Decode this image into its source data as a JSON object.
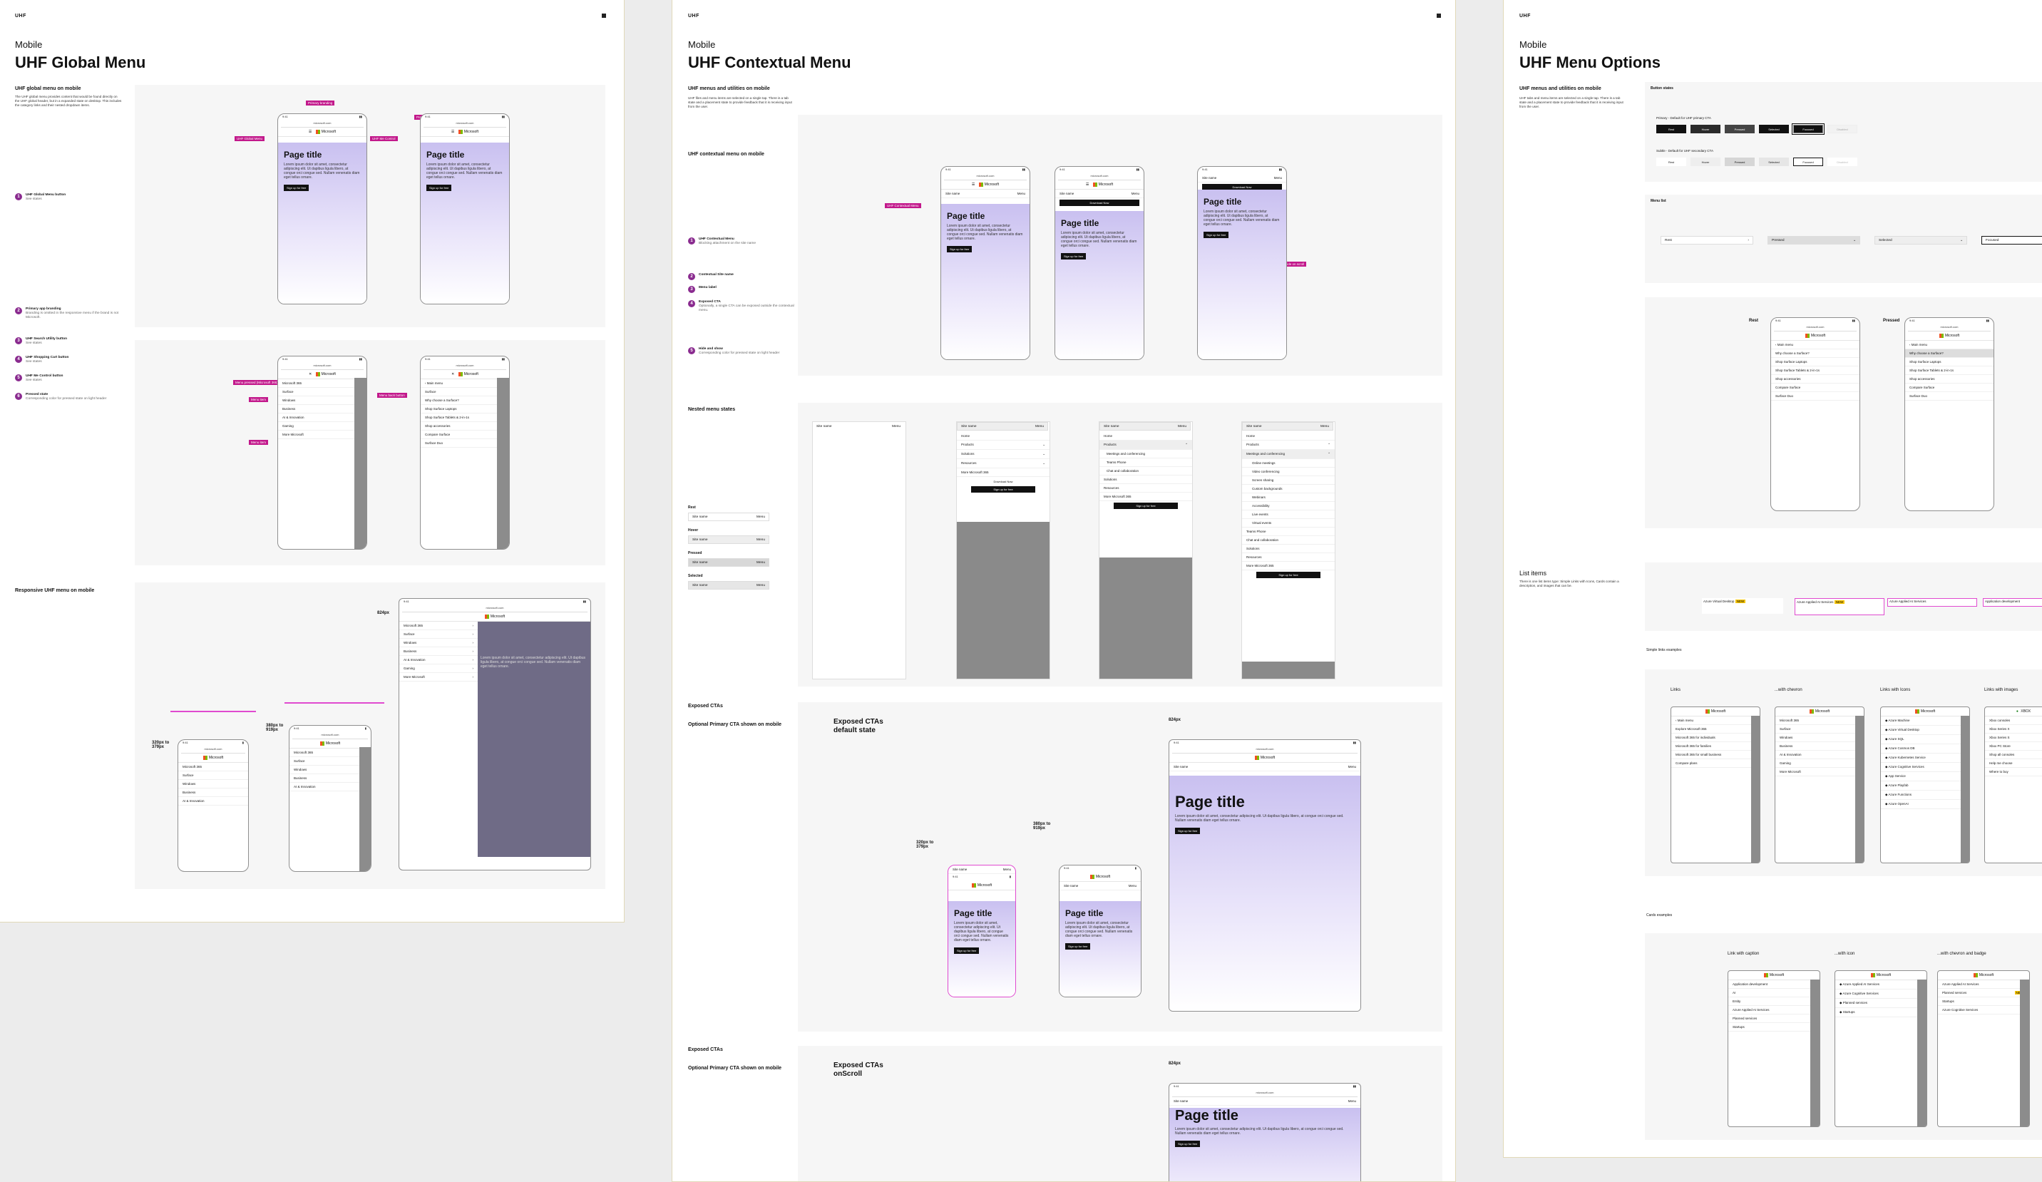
{
  "brand_short": "UHF",
  "boards": [
    {
      "kicker": "Mobile",
      "title": "UHF Global Menu"
    },
    {
      "kicker": "Mobile",
      "title": "UHF Contextual Menu"
    },
    {
      "kicker": "Mobile",
      "title": "UHF Menu Options"
    }
  ],
  "global": {
    "section1": "UHF global menu on mobile",
    "intro": "The UHF global menu provides content that would be found directly on the UHF global header, but in a expanded state on desktop. This includes the category links and their nested dropdown items.",
    "steps": [
      {
        "n": "1",
        "label": "UHF Global Menu button",
        "desc": "See states"
      },
      {
        "n": "2",
        "label": "Primary app branding",
        "desc": "Branding is omitted in the responsive menu if the brand is not Microsoft."
      },
      {
        "n": "3",
        "label": "UHF Search Utility button",
        "desc": "See states"
      },
      {
        "n": "4",
        "label": "UHF Shopping Cart button",
        "desc": "See states"
      },
      {
        "n": "5",
        "label": "UHF Me Control button",
        "desc": "See states"
      },
      {
        "n": "6",
        "label": "Pressed state",
        "desc": "Corresponding color for pressed state on light header"
      }
    ],
    "section2": "Responsive UHF menu on mobile",
    "bp1": "320px to 379px",
    "bp2": "380px to 919px",
    "bp3": "824px",
    "tags": [
      "Primary branding",
      "UHF Global Menu",
      "UHF Search",
      "UHF Cart",
      "UHF Me Control",
      "Pressed state",
      "Menu pressed (Microsoft 365)",
      "Menu item",
      "Menu item",
      "Menu back button"
    ],
    "phone_url": "microsoft.com",
    "phone_time": "9:41",
    "brand": "Microsoft",
    "page_title": "Page title",
    "body": "Lorem ipsum dolor sit amet, consectetur adipiscing elit. Ut dapibus ligula libero, at congue orci congue sed. Nullam venenatis diam eget tellus ornare.",
    "cta_link": "Sign up for free",
    "cta_primary": "Sign up for free",
    "menu_items": [
      "Microsoft 365",
      "Surface",
      "Windows",
      "Business",
      "AI & Innovation",
      "Gaming",
      "More Microsoft"
    ],
    "submenu_back": "Main menu",
    "submenu_head": "Surface",
    "submenu_items": [
      "Why choose a Surface?",
      "Shop Surface Laptops",
      "Shop Surface Tablets & 2-in-1s",
      "Shop accessories",
      "Compare Surface",
      "Surface Duo"
    ]
  },
  "contextual": {
    "section1": "UHF menus and utilities on mobile",
    "intro": "UHF files and menu items are selected on a single tap. There is a tab state and a placement state to provide feedback that it is receiving input from the user.",
    "section2": "UHF contextual menu on mobile",
    "steps": [
      {
        "n": "1",
        "label": "UHF Contextual Menu",
        "desc": "Blocking attachment on the site name"
      },
      {
        "n": "2",
        "label": "Contextual Site name",
        "desc": ""
      },
      {
        "n": "3",
        "label": "Menu label",
        "desc": ""
      },
      {
        "n": "4",
        "label": "Exposed CTA",
        "desc": "Optionally, a single CTA can be exposed outside the contextual menu."
      },
      {
        "n": "5",
        "label": "Hide and show",
        "desc": "Corresponding color for pressed state on light header"
      }
    ],
    "section3": "Nested menu states",
    "state_labels": [
      "Rest",
      "Hover",
      "Pressed",
      "Selected"
    ],
    "site_name": "Site name",
    "menu_label": "Menu",
    "download": "Download Now",
    "ctx_items": [
      "Home",
      "Products",
      "Solutions",
      "Resources",
      "More Microsoft 365"
    ],
    "ctx_sub": [
      "Meetings and conferencing",
      "Teams Phone",
      "Chat and collaboration"
    ],
    "ctx_sub2": [
      "Online meetings",
      "Video conferencing",
      "Screen sharing",
      "Custom backgrounds",
      "Webinars",
      "Accessibility",
      "Live events",
      "Virtual events"
    ],
    "section4": "Exposed CTAs",
    "opt_cta": "Optional Primary CTA shown on mobile",
    "exposed_default": "Exposed CTAs default state",
    "exposed_scroll": "Exposed CTAs onScroll",
    "bp1": "320px to 379px",
    "bp2": "380px to 919px",
    "bp3": "824px",
    "tags": [
      "UHF Contextual Menu",
      "Contextual Site name",
      "Menu label",
      "Optional exposed CTA",
      "Hide on scroll"
    ]
  },
  "options": {
    "section1": "UHF menus and utilities on mobile",
    "intro": "UHF tabs and menu items are selected on a single tap. There is a tab state and a placement state to provide feedback that it is receiving input from the user.",
    "button_states": "Button states",
    "primary_label": "Primary - Default for UHF primary CTA",
    "subtle_label": "Subtle - Default for UHF secondary CTA",
    "states": [
      "Rest",
      "Hover",
      "Pressed",
      "Selected",
      "Focused",
      "Disabled"
    ],
    "menu_list": "Menu list",
    "list_states": [
      "Rest",
      "Pressed",
      "Selected",
      "Focused"
    ],
    "rest": "Rest",
    "pressed": "Pressed",
    "list_items": "List items",
    "list_intro": "There is one list items type: Simple Links with Icons, Cards contain a description, and images that can be.",
    "simple_links": "Simple links examples",
    "col_heads": [
      "Links",
      "...with chevron",
      "Links with Icons",
      "Links with images"
    ],
    "cards_examples": "Cards examples",
    "card_heads": [
      "Link with caption",
      "...with icon",
      "...with chevron and badge"
    ],
    "link_items": [
      "Explore Microsoft 365",
      "Microsoft 365 for individuals",
      "Microsoft 365 for families",
      "Microsoft 365 for small business",
      "Compare plans"
    ],
    "icon_items": [
      "Azure Machine",
      "Azure Virtual Desktop",
      "Azure SQL",
      "Azure Cosmos DB",
      "Azure Kubernetes Service",
      "Azure Cognitive Services",
      "App Service",
      "Azure Playfab",
      "Azure Functions",
      "Azure OpenAI"
    ],
    "img_items": [
      "Xbox consoles",
      "Xbox Series X",
      "Xbox Series S",
      "Xbox PC Store",
      "Shop all consoles",
      "Help me choose",
      "Where to buy"
    ],
    "card_items": [
      "Application development",
      "AI",
      "Entity",
      "Azure Applied AI Services",
      "Planned services",
      "Startups"
    ],
    "new_badge": "NEW"
  }
}
